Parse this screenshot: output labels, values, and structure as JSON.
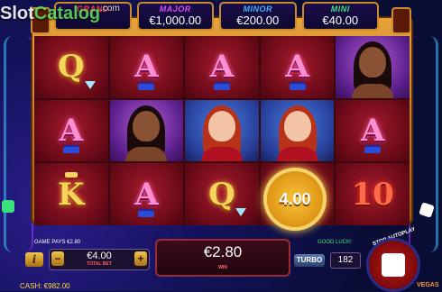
{
  "watermark": {
    "slot": "Slot",
    "catalog": "Catalog",
    "domain": ".com"
  },
  "jackpots": [
    {
      "label": "GRAND",
      "amount": "",
      "color": "#ff3b3b"
    },
    {
      "label": "MAJOR",
      "amount": "€1,000.00",
      "color": "#d84bff"
    },
    {
      "label": "MINOR",
      "amount": "€200.00",
      "color": "#3fb5ff"
    },
    {
      "label": "MINI",
      "amount": "€40.00",
      "color": "#3be07a"
    }
  ],
  "reels": {
    "rows": [
      [
        "Q",
        "A",
        "A",
        "A",
        "lady"
      ],
      [
        "A",
        "lady",
        "redhead",
        "redhead",
        "A"
      ],
      [
        "K",
        "A",
        "Q",
        "chip",
        "10"
      ]
    ]
  },
  "chip": {
    "value": "4.00"
  },
  "bottom": {
    "game_pays": "GAME PAYS €2.80",
    "good_luck": "GOOD LUCK!",
    "info_label": "i",
    "bet_value": "€4.00",
    "bet_label": "TOTAL BET",
    "minus": "−",
    "plus": "+",
    "win_value": "€2.80",
    "win_label": "WIN",
    "turbo": "TURBO",
    "autoplay_count": "182",
    "stop_autoplay": "STOP AUTOPLAY",
    "cash": "CASH: €982.00",
    "brand": "VEGAS"
  }
}
